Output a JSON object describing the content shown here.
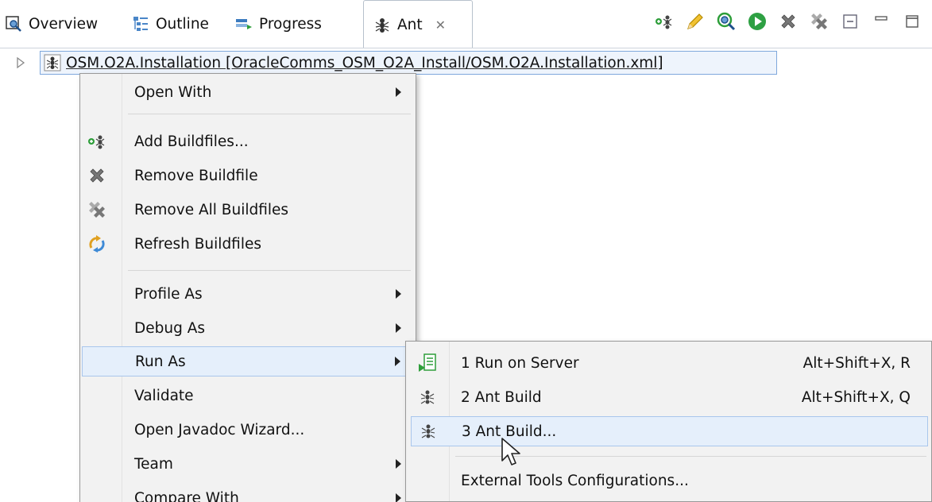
{
  "tabs": [
    {
      "label": "Overview",
      "icon": "overview-icon"
    },
    {
      "label": "Outline",
      "icon": "outline-icon"
    },
    {
      "label": "Progress",
      "icon": "progress-icon"
    },
    {
      "label": "Ant",
      "icon": "ant-icon",
      "active": true
    }
  ],
  "toolbar": {
    "icons": [
      "add-buildfile-icon",
      "edit-icon",
      "search-buildfile-icon",
      "run-icon",
      "remove-icon",
      "remove-all-icon",
      "collapse-icon",
      "minimize-icon",
      "maximize-icon"
    ]
  },
  "tree": {
    "item_label": "OSM.O2A.Installation [OracleComms_OSM_O2A_Install/OSM.O2A.Installation.xml]"
  },
  "context_menu": {
    "items": [
      {
        "label": "Open With",
        "submenu": true
      },
      {
        "label": "Add Buildfiles...",
        "icon": "add-buildfile-icon"
      },
      {
        "label": "Remove Buildfile",
        "icon": "remove-icon"
      },
      {
        "label": "Remove All Buildfiles",
        "icon": "remove-all-icon"
      },
      {
        "label": "Refresh Buildfiles",
        "icon": "refresh-icon"
      },
      {
        "label": "Profile As",
        "submenu": true
      },
      {
        "label": "Debug As",
        "submenu": true
      },
      {
        "label": "Run As",
        "submenu": true,
        "highlighted": true
      },
      {
        "label": "Validate"
      },
      {
        "label": "Open Javadoc Wizard..."
      },
      {
        "label": "Team",
        "submenu": true
      },
      {
        "label": "Compare With",
        "submenu": true
      }
    ]
  },
  "run_as_submenu": {
    "items": [
      {
        "label": "1 Run on Server",
        "accelerator": "Alt+Shift+X, R",
        "icon": "run-on-server-icon"
      },
      {
        "label": "2 Ant Build",
        "accelerator": "Alt+Shift+X, Q",
        "icon": "ant-icon"
      },
      {
        "label": "3 Ant Build...",
        "accelerator": "",
        "icon": "ant-icon",
        "highlighted": true
      },
      {
        "label": "External Tools Configurations...",
        "accelerator": ""
      }
    ]
  },
  "colors": {
    "highlight_bg": "#e5effb",
    "highlight_border": "#a9c6ec",
    "menu_bg": "#f2f2f2",
    "selection_border": "#7fa8dc"
  }
}
